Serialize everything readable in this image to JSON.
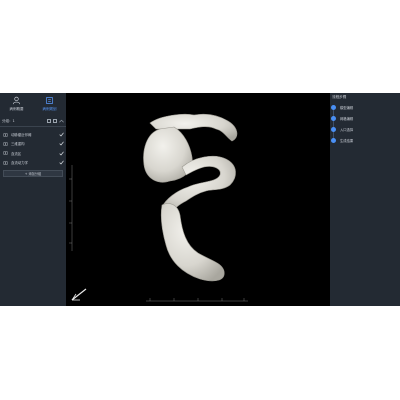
{
  "nav": {
    "items": [
      {
        "label": "病例概要",
        "icon": "person-icon",
        "active": false
      },
      {
        "label": "病例规划",
        "icon": "cube-icon",
        "active": true
      }
    ]
  },
  "toolbar": {
    "label": "分组：1"
  },
  "layers": [
    {
      "label": "动脉瘤近邻阈",
      "checked": true
    },
    {
      "label": "三维重构",
      "checked": true
    },
    {
      "label": "血流区",
      "checked": true
    },
    {
      "label": "血流动力学",
      "checked": true
    }
  ],
  "add_button": {
    "label": "+ 添加分组"
  },
  "steps": [
    {
      "label": "模型编辑"
    },
    {
      "label": "网格编辑"
    },
    {
      "label": "入口选择"
    },
    {
      "label": "生成结果"
    }
  ],
  "right_panel": {
    "title": "流程步骤"
  },
  "colors": {
    "panel": "#232a33",
    "accent": "#4a90f5",
    "viewport": "#000000",
    "vessel": "#e4e3de"
  }
}
